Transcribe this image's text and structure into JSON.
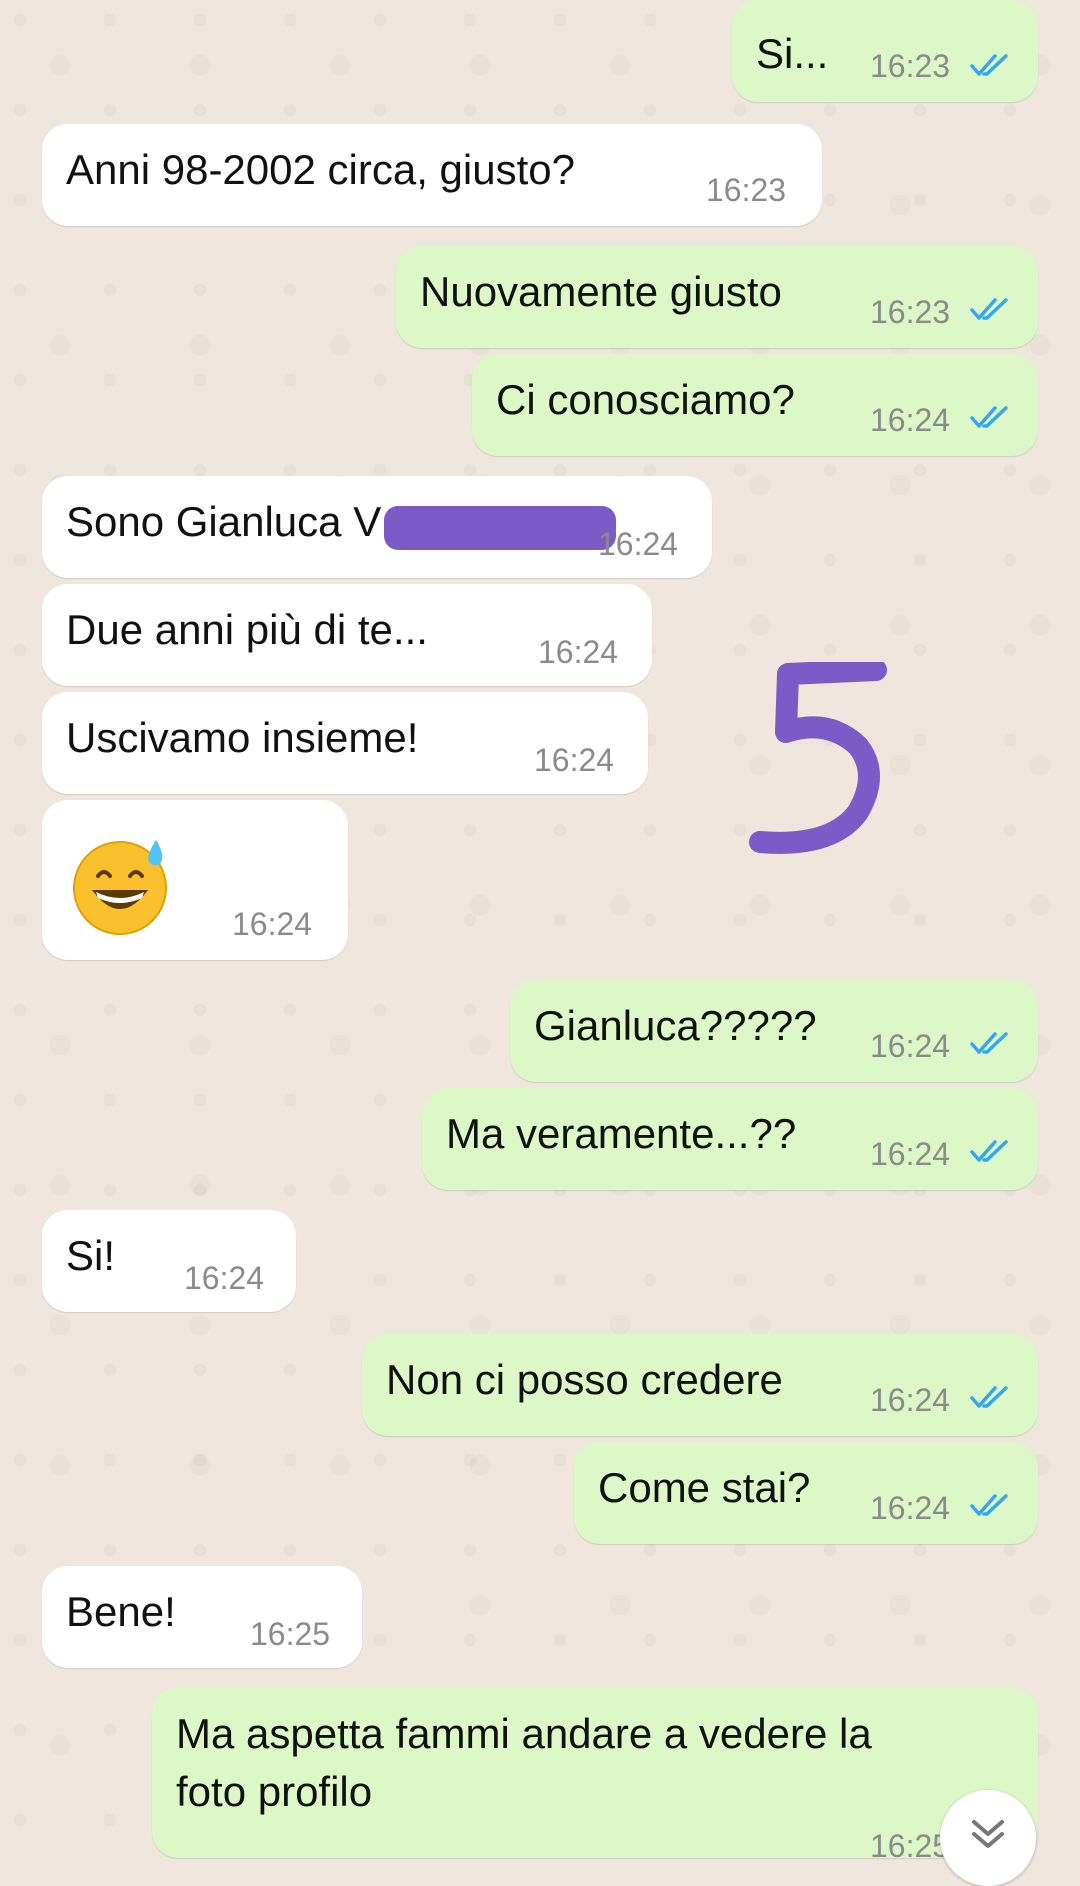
{
  "messages": [
    {
      "dir": "out",
      "text": "Si...",
      "time": "16:23",
      "read": true
    },
    {
      "dir": "in",
      "text": "Anni 98-2002 circa, giusto?",
      "time": "16:23"
    },
    {
      "dir": "out",
      "text": "Nuovamente giusto",
      "time": "16:23",
      "read": true
    },
    {
      "dir": "out",
      "text": "Ci conosciamo?",
      "time": "16:24",
      "read": true
    },
    {
      "dir": "in",
      "text": "Sono Gianluca V",
      "time": "16:24",
      "redacted": true
    },
    {
      "dir": "in",
      "text": "Due anni più di te...",
      "time": "16:24"
    },
    {
      "dir": "in",
      "text": "Uscivamo insieme!",
      "time": "16:24"
    },
    {
      "dir": "in",
      "emoji": "grinning-sweat-emoji",
      "time": "16:24"
    },
    {
      "dir": "out",
      "text": "Gianluca?????",
      "time": "16:24",
      "read": true
    },
    {
      "dir": "out",
      "text": "Ma veramente...??",
      "time": "16:24",
      "read": true
    },
    {
      "dir": "in",
      "text": "Si!",
      "time": "16:24"
    },
    {
      "dir": "out",
      "text": "Non ci posso credere",
      "time": "16:24",
      "read": true
    },
    {
      "dir": "out",
      "text": "Come stai?",
      "time": "16:24",
      "read": true
    },
    {
      "dir": "in",
      "text": "Bene!",
      "time": "16:25"
    },
    {
      "dir": "out",
      "text_line1": "Ma aspetta fammi andare a vedere la",
      "text_line2": "foto profilo",
      "time": "16:25",
      "read": true
    }
  ],
  "annotation": "5",
  "icons": {
    "read_ticks": "double-check-icon",
    "scroll_down": "chevron-double-down-icon"
  },
  "colors": {
    "incoming_bubble": "#ffffff",
    "outgoing_bubble": "#dcf8c6",
    "tick_blue": "#34a7f0",
    "redaction": "#7b5bc8",
    "wallpaper": "#efe7de"
  }
}
